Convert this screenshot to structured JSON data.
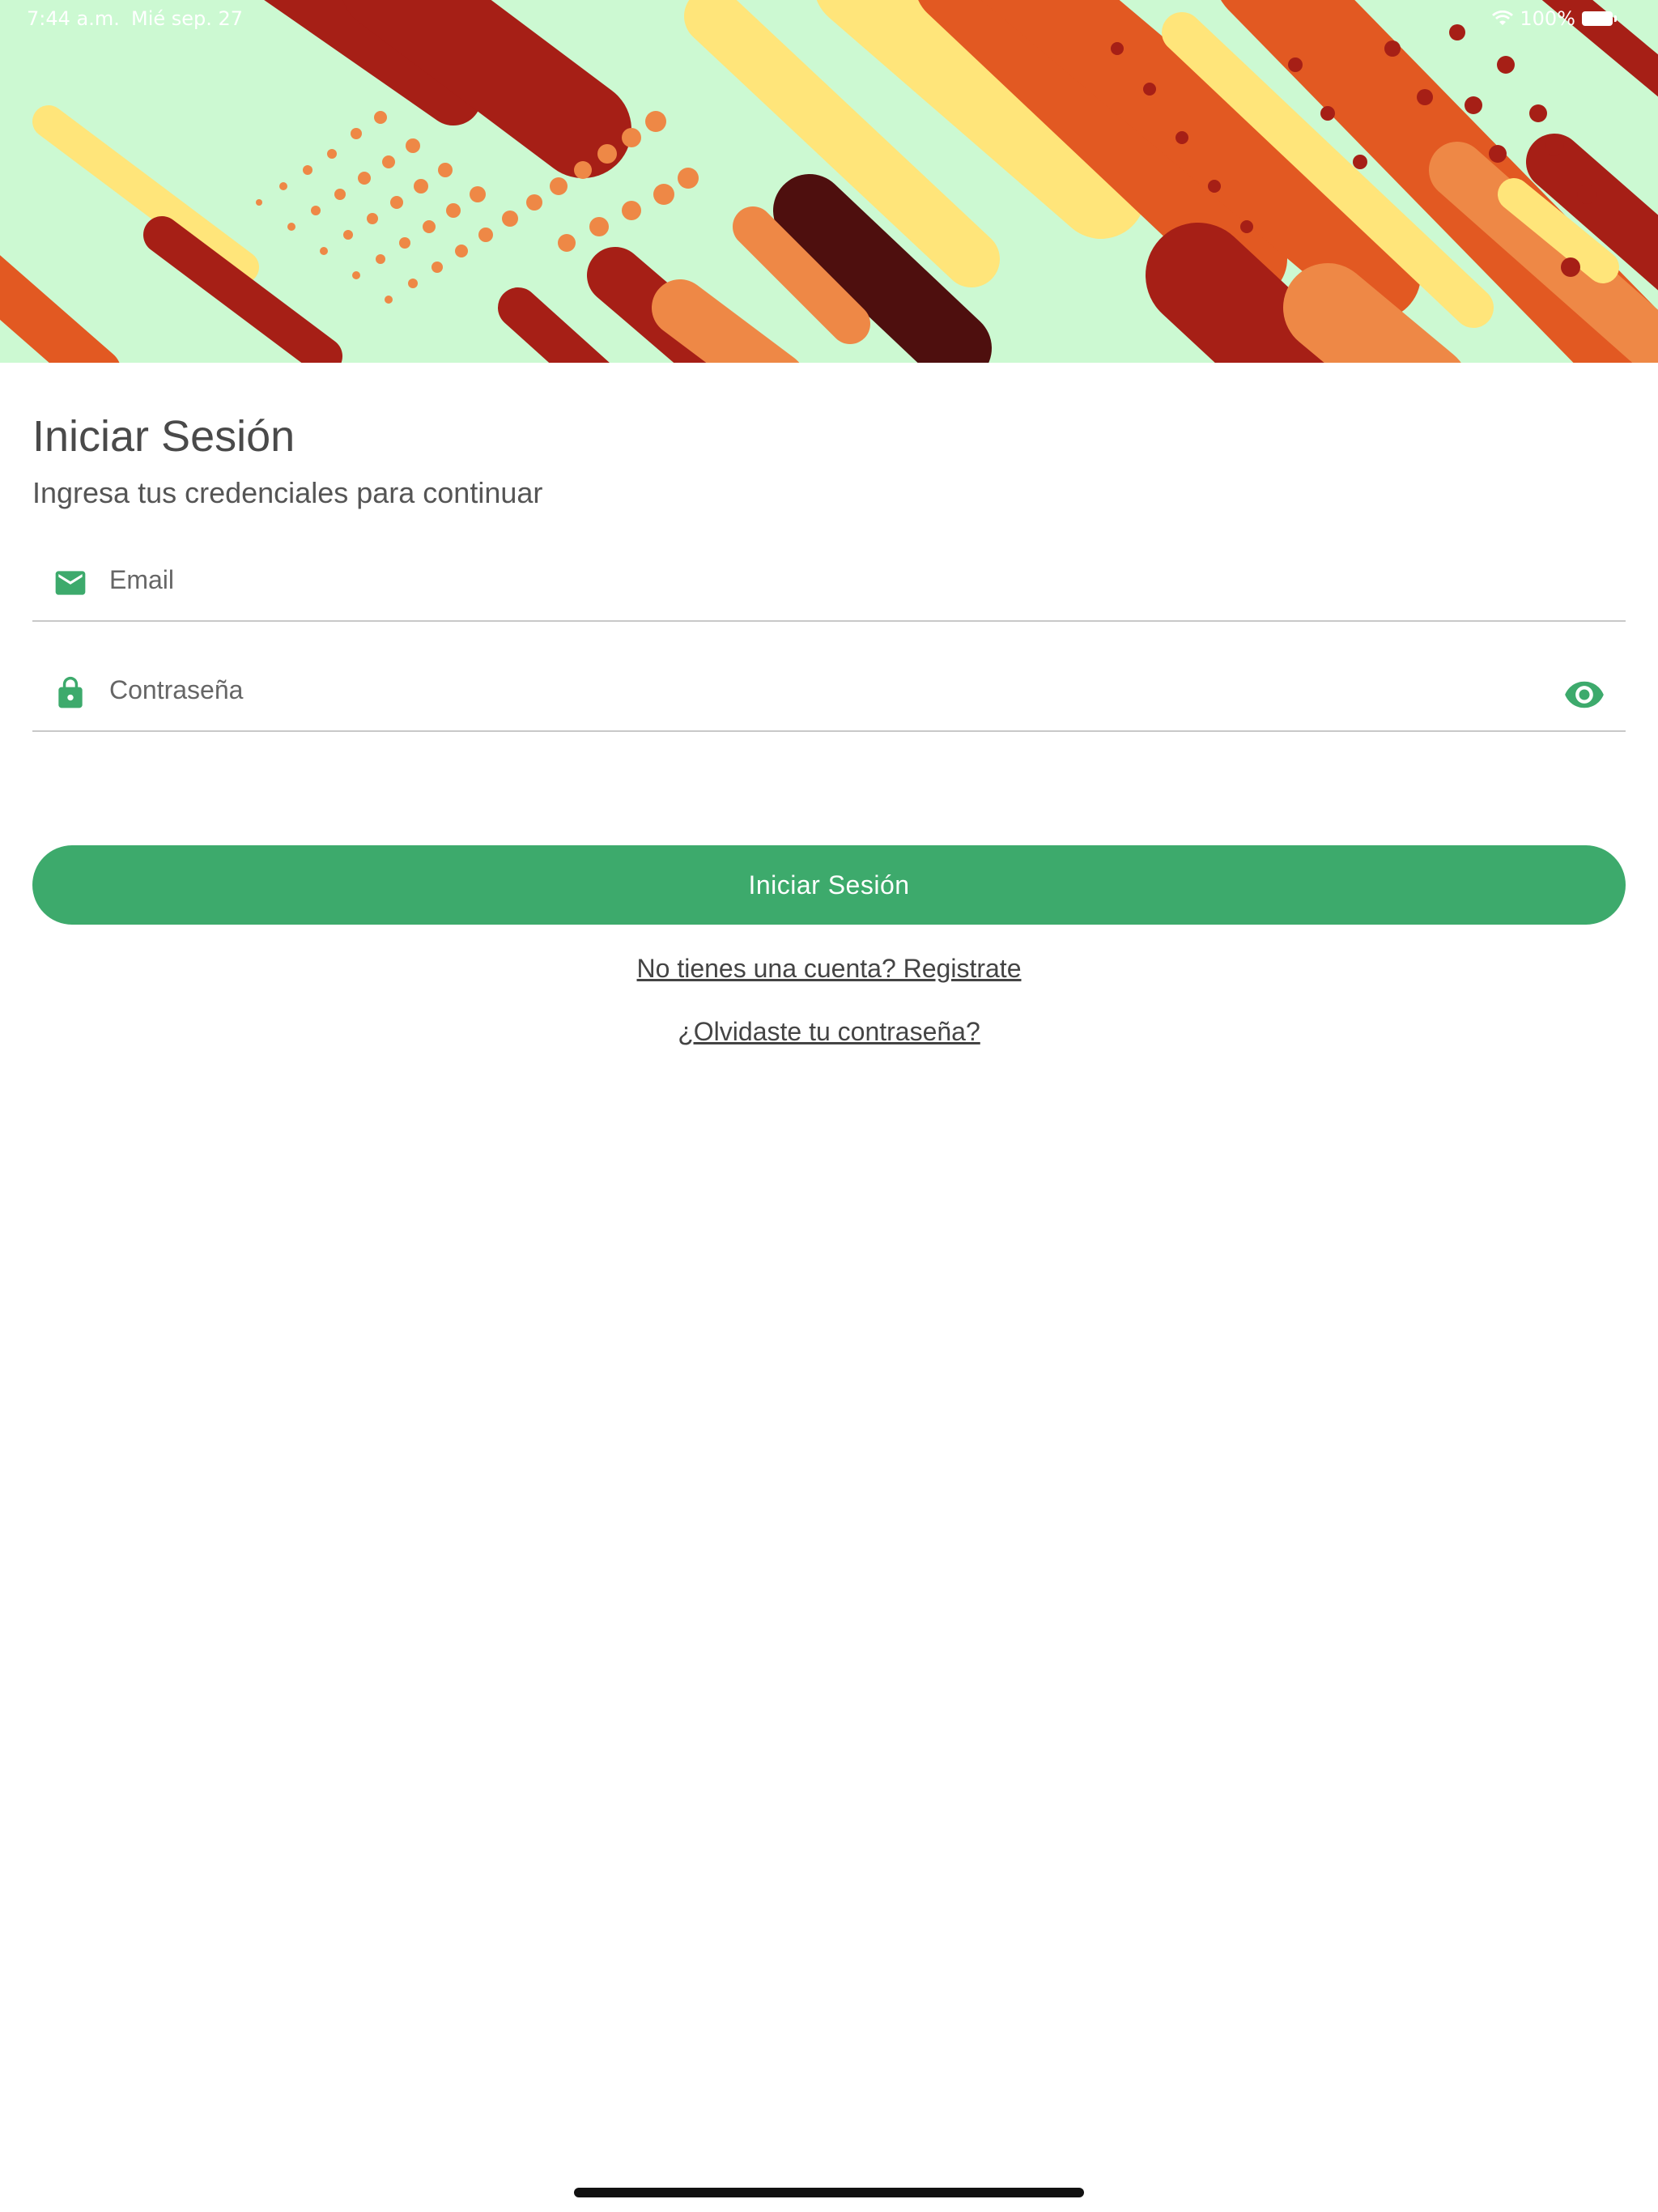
{
  "status_bar": {
    "time": "7:44 a.m.",
    "date": "Mié sep. 27",
    "battery": "100%"
  },
  "login": {
    "title": "Iniciar Sesión",
    "subtitle": "Ingresa tus credenciales para continuar",
    "email_placeholder": "Email",
    "email_value": "",
    "password_placeholder": "Contraseña",
    "password_value": "",
    "submit_label": "Iniciar Sesión",
    "register_link": "No tienes una cuenta? Registrate",
    "forgot_link": "¿Olvidaste tu contraseña?"
  },
  "icons": {
    "email": "mail-icon",
    "password": "lock-icon",
    "toggle_visibility": "eye-icon",
    "wifi": "wifi-icon",
    "battery": "battery-icon"
  },
  "colors": {
    "accent": "#3daa6c",
    "banner_background": "#ccf9d2",
    "text_primary": "#4a4a4a"
  }
}
